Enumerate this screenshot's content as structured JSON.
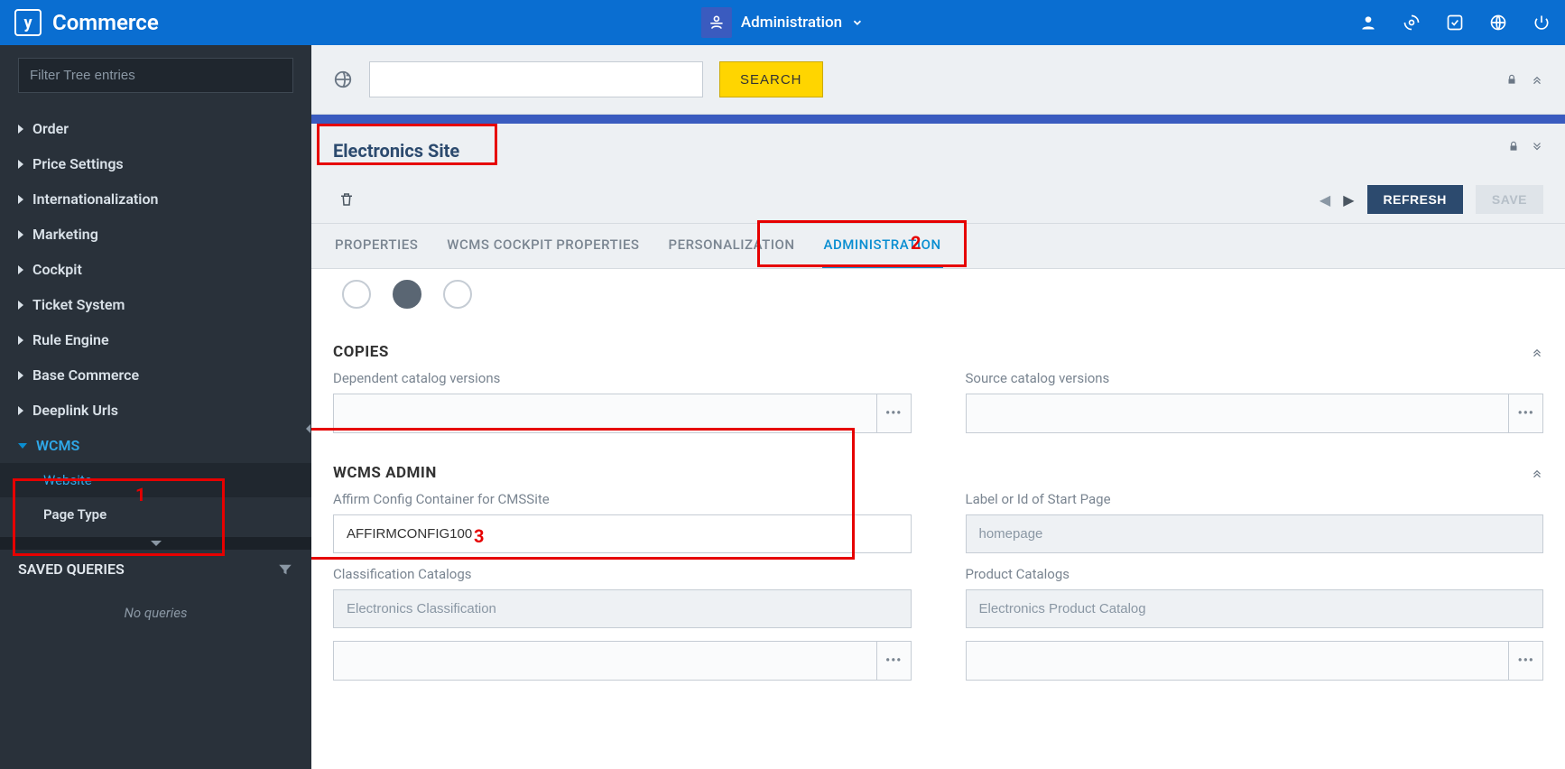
{
  "brand": {
    "title": "Commerce"
  },
  "topnav": {
    "context": "Administration"
  },
  "sidebar": {
    "filter_placeholder": "Filter Tree entries",
    "items": [
      {
        "label": "Order"
      },
      {
        "label": "Price Settings"
      },
      {
        "label": "Internationalization"
      },
      {
        "label": "Marketing"
      },
      {
        "label": "Cockpit"
      },
      {
        "label": "Ticket System"
      },
      {
        "label": "Rule Engine"
      },
      {
        "label": "Base Commerce"
      },
      {
        "label": "Deeplink Urls"
      },
      {
        "label": "WCMS",
        "open": true,
        "children": [
          {
            "label": "Website",
            "active": true
          },
          {
            "label": "Page Type"
          }
        ]
      }
    ],
    "saved_queries_title": "SAVED QUERIES",
    "no_queries": "No queries"
  },
  "search": {
    "button": "SEARCH"
  },
  "detail": {
    "title": "Electronics Site",
    "refresh": "REFRESH",
    "save": "SAVE",
    "tabs": {
      "properties": "PROPERTIES",
      "wcms_cockpit": "WCMS COCKPIT PROPERTIES",
      "personalization": "PERSONALIZATION",
      "administration": "ADMINISTRATION"
    }
  },
  "sections": {
    "copies": {
      "title": "COPIES",
      "dep_label": "Dependent catalog versions",
      "src_label": "Source catalog versions"
    },
    "wcms_admin": {
      "title": "WCMS ADMIN",
      "affirm_label": "Affirm Config Container for CMSSite",
      "affirm_value": "AFFIRMCONFIG100",
      "startpage_label": "Label or Id of Start Page",
      "startpage_value": "homepage",
      "class_cat_label": "Classification Catalogs",
      "class_cat_value": "Electronics Classification",
      "prod_cat_label": "Product Catalogs",
      "prod_cat_value": "Electronics Product Catalog"
    }
  },
  "annotations": {
    "n1": "1",
    "n2": "2",
    "n3": "3"
  }
}
